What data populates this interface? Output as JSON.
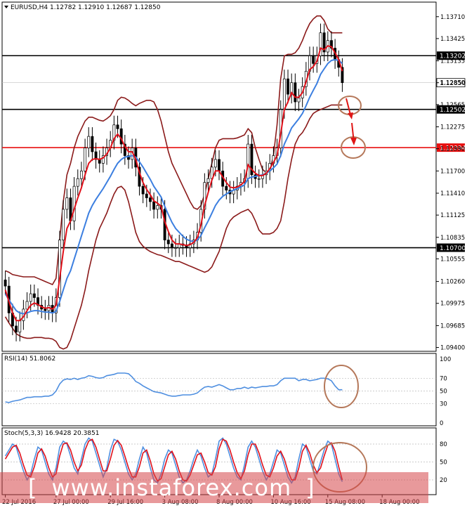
{
  "watermark": {
    "text": "www.instaforex.com",
    "bracket_left": "[",
    "bracket_right": "]"
  },
  "colors": {
    "price_up": "#000000",
    "price_down": "#000000",
    "bands": "#8b1a1a",
    "ma_fast": "#e0101a",
    "ma_slow": "#3c7fe0",
    "level_black": "#000000",
    "level_red": "#e81010",
    "annotation": "#b5785a",
    "arrow": "#e01515",
    "rsi_line": "#4f8fe0",
    "stoch_main": "#4f8fe0",
    "stoch_signal": "#e0101a"
  },
  "chart_data": [
    {
      "type": "line",
      "title": "EURUSD,H4  1.12782 1.12910 1.12687 1.12850",
      "ylim": [
        1.0935,
        1.139
      ],
      "yticks": [
        "1.13710",
        "1.13425",
        "1.13135",
        "1.12850",
        "1.12565",
        "1.12275",
        "1.11990",
        "1.11700",
        "1.11410",
        "1.11125",
        "1.10835",
        "1.10555",
        "1.10260",
        "1.09975",
        "1.09685",
        "1.09400"
      ],
      "ytick_values": [
        1.1371,
        1.13425,
        1.13135,
        1.1285,
        1.12565,
        1.12275,
        1.1199,
        1.117,
        1.1141,
        1.11125,
        1.10835,
        1.10555,
        1.1026,
        1.09975,
        1.09685,
        1.094
      ],
      "xlabels": [
        "22 Jul 2016",
        "27 Jul 00:00",
        "29 Jul 16:00",
        "3 Aug 08:00",
        "8 Aug 00:00",
        "10 Aug 16:00",
        "15 Aug 08:00",
        "18 Aug 00:00"
      ],
      "xlabel_bars": [
        0,
        14,
        29,
        44,
        59,
        74,
        89,
        104
      ],
      "levels": [
        {
          "value": 1.13202,
          "label": "1.13202",
          "color": "#000000"
        },
        {
          "value": 1.12502,
          "label": "1.12502",
          "color": "#000000"
        },
        {
          "value": 1.12004,
          "label": "1.12004",
          "color": "#e81010"
        },
        {
          "value": 1.107,
          "label": "1.10700",
          "color": "#000000"
        }
      ],
      "current_price": {
        "value": 1.1285,
        "label": "1.12850"
      },
      "close": [
        1.102,
        1.0985,
        1.0968,
        1.096,
        1.0975,
        1.099,
        1.1,
        1.101,
        1.1005,
        1.0995,
        1.099,
        1.0988,
        1.0995,
        1.0985,
        1.1005,
        1.108,
        1.112,
        1.1135,
        1.1105,
        1.115,
        1.116,
        1.117,
        1.12,
        1.1215,
        1.1195,
        1.1185,
        1.118,
        1.119,
        1.12,
        1.121,
        1.123,
        1.1225,
        1.1205,
        1.119,
        1.1185,
        1.12,
        1.1175,
        1.115,
        1.114,
        1.1135,
        1.113,
        1.112,
        1.1125,
        1.112,
        1.108,
        1.1075,
        1.107,
        1.107,
        1.1075,
        1.1073,
        1.107,
        1.1075,
        1.108,
        1.109,
        1.112,
        1.1155,
        1.116,
        1.1175,
        1.1185,
        1.117,
        1.115,
        1.1145,
        1.114,
        1.1145,
        1.115,
        1.1155,
        1.116,
        1.1205,
        1.1165,
        1.116,
        1.116,
        1.1165,
        1.117,
        1.118,
        1.119,
        1.12,
        1.125,
        1.129,
        1.127,
        1.1285,
        1.126,
        1.1265,
        1.128,
        1.13,
        1.132,
        1.131,
        1.132,
        1.135,
        1.1325,
        1.134,
        1.133,
        1.1315,
        1.1305,
        1.1285
      ],
      "ma_fast": [
        1.1015,
        1.1,
        1.0985,
        1.0975,
        1.0975,
        1.098,
        1.0988,
        1.0995,
        1.0998,
        1.0996,
        1.0993,
        1.0991,
        1.0992,
        1.099,
        1.0995,
        1.103,
        1.1065,
        1.1095,
        1.1105,
        1.112,
        1.1135,
        1.1148,
        1.1165,
        1.118,
        1.1185,
        1.1186,
        1.1185,
        1.1187,
        1.1192,
        1.12,
        1.1212,
        1.1218,
        1.1212,
        1.1202,
        1.1195,
        1.1195,
        1.1185,
        1.1168,
        1.1155,
        1.1146,
        1.1139,
        1.1131,
        1.1128,
        1.1124,
        1.1104,
        1.1091,
        1.108,
        1.1075,
        1.1075,
        1.1074,
        1.1073,
        1.1074,
        1.1077,
        1.1083,
        1.11,
        1.1125,
        1.1142,
        1.1158,
        1.117,
        1.117,
        1.1162,
        1.1155,
        1.1149,
        1.1148,
        1.1149,
        1.1152,
        1.1156,
        1.1178,
        1.1172,
        1.1167,
        1.1164,
        1.1164,
        1.1167,
        1.1173,
        1.1181,
        1.119,
        1.1218,
        1.125,
        1.126,
        1.1272,
        1.1266,
        1.1266,
        1.1272,
        1.1286,
        1.1302,
        1.1306,
        1.1313,
        1.133,
        1.1328,
        1.1333,
        1.1332,
        1.1324,
        1.1315,
        1.13
      ],
      "ma_slow": [
        1.101,
        1.1002,
        1.0995,
        1.0988,
        1.0985,
        1.0984,
        1.0985,
        1.0987,
        1.0988,
        1.0988,
        1.0987,
        1.0986,
        1.0986,
        1.0985,
        1.0987,
        1.1,
        1.1015,
        1.103,
        1.104,
        1.1055,
        1.107,
        1.1085,
        1.11,
        1.1115,
        1.1125,
        1.1133,
        1.114,
        1.1147,
        1.1155,
        1.1163,
        1.1172,
        1.118,
        1.1185,
        1.1188,
        1.1189,
        1.119,
        1.1188,
        1.1182,
        1.1175,
        1.1167,
        1.1159,
        1.115,
        1.1143,
        1.1136,
        1.1124,
        1.1113,
        1.1103,
        1.1095,
        1.109,
        1.1085,
        1.1081,
        1.1079,
        1.1078,
        1.108,
        1.1086,
        1.1096,
        1.1105,
        1.1115,
        1.1125,
        1.1132,
        1.1137,
        1.114,
        1.1143,
        1.1145,
        1.1147,
        1.1149,
        1.1152,
        1.116,
        1.1162,
        1.1163,
        1.1164,
        1.1165,
        1.1167,
        1.117,
        1.1174,
        1.1179,
        1.119,
        1.1205,
        1.1215,
        1.1226,
        1.1232,
        1.1238,
        1.1245,
        1.1255,
        1.1266,
        1.1275,
        1.1284,
        1.1296,
        1.1303,
        1.131,
        1.1314,
        1.1315,
        1.1314,
        1.131
      ],
      "upper_band": [
        1.104,
        1.1038,
        1.1035,
        1.1034,
        1.1033,
        1.1032,
        1.1032,
        1.1032,
        1.1032,
        1.103,
        1.1028,
        1.1026,
        1.1024,
        1.1022,
        1.103,
        1.108,
        1.113,
        1.1165,
        1.118,
        1.12,
        1.1215,
        1.1225,
        1.1235,
        1.124,
        1.124,
        1.1238,
        1.1236,
        1.1235,
        1.1238,
        1.1242,
        1.125,
        1.1262,
        1.1266,
        1.1265,
        1.1262,
        1.1258,
        1.1255,
        1.1258,
        1.126,
        1.1262,
        1.1262,
        1.126,
        1.125,
        1.1235,
        1.1215,
        1.1195,
        1.118,
        1.117,
        1.116,
        1.115,
        1.114,
        1.113,
        1.1122,
        1.112,
        1.1125,
        1.114,
        1.116,
        1.118,
        1.12,
        1.121,
        1.1212,
        1.1212,
        1.1212,
        1.1212,
        1.1213,
        1.1215,
        1.1217,
        1.1225,
        1.122,
        1.12,
        1.1185,
        1.1172,
        1.1168,
        1.117,
        1.119,
        1.123,
        1.129,
        1.132,
        1.1322,
        1.1322,
        1.1324,
        1.133,
        1.134,
        1.1352,
        1.1362,
        1.1368,
        1.1372,
        1.1372,
        1.1366,
        1.1355,
        1.135,
        1.135,
        1.135,
        1.135
      ],
      "lower_band": [
        1.098,
        1.0972,
        1.0965,
        1.0958,
        1.0955,
        1.0953,
        1.0952,
        1.0952,
        1.0953,
        1.0953,
        1.0953,
        1.0952,
        1.0952,
        1.0951,
        1.0948,
        1.094,
        1.0938,
        1.094,
        1.095,
        1.0965,
        1.098,
        1.0995,
        1.1015,
        1.104,
        1.106,
        1.108,
        1.1095,
        1.1105,
        1.1115,
        1.1128,
        1.114,
        1.1148,
        1.115,
        1.1145,
        1.113,
        1.111,
        1.109,
        1.1078,
        1.1072,
        1.1068,
        1.1065,
        1.1063,
        1.1061,
        1.106,
        1.1058,
        1.1056,
        1.1054,
        1.1052,
        1.1052,
        1.105,
        1.1048,
        1.1046,
        1.1044,
        1.1042,
        1.104,
        1.1038,
        1.104,
        1.1045,
        1.1055,
        1.1065,
        1.108,
        1.1095,
        1.1105,
        1.111,
        1.1113,
        1.1116,
        1.1118,
        1.112,
        1.1115,
        1.1105,
        1.1093,
        1.1088,
        1.1088,
        1.1088,
        1.109,
        1.1095,
        1.1105,
        1.113,
        1.116,
        1.1185,
        1.1205,
        1.1215,
        1.122,
        1.1228,
        1.1238,
        1.1245,
        1.1248,
        1.125,
        1.1252,
        1.1254,
        1.1256,
        1.1256,
        1.1256,
        1.1256
      ]
    },
    {
      "type": "line",
      "title": "RSI(14) 51.8062",
      "ylim": [
        0,
        100
      ],
      "yticks": [
        "100",
        "70",
        "50",
        "30",
        "0"
      ],
      "ytick_values": [
        100,
        70,
        50,
        30,
        0
      ],
      "values": [
        33,
        32,
        34,
        35,
        36,
        38,
        40,
        40,
        41,
        41,
        41,
        42,
        42,
        44,
        50,
        61,
        67,
        69,
        68,
        70,
        68,
        70,
        71,
        74,
        73,
        71,
        70,
        71,
        74,
        75,
        76,
        78,
        78,
        78,
        77,
        72,
        65,
        62,
        58,
        55,
        52,
        49,
        48,
        47,
        45,
        43,
        42,
        42,
        43,
        44,
        44,
        44,
        45,
        47,
        52,
        56,
        57,
        56,
        58,
        60,
        58,
        55,
        52,
        52,
        54,
        54,
        56,
        54,
        56,
        55,
        56,
        57,
        57,
        58,
        58,
        60,
        66,
        70,
        70,
        70,
        70,
        66,
        68,
        68,
        66,
        67,
        68,
        70,
        70,
        69,
        66,
        58,
        52,
        52
      ]
    },
    {
      "type": "line",
      "title": "Stoch(5,3,3) 16.9428 20.3851",
      "ylim": [
        0,
        100
      ],
      "yticks": [
        "80",
        "50",
        "20"
      ],
      "ytick_values": [
        80,
        50,
        20
      ],
      "main": [
        60,
        70,
        80,
        75,
        55,
        35,
        20,
        30,
        55,
        75,
        70,
        50,
        30,
        20,
        40,
        75,
        85,
        80,
        60,
        40,
        30,
        55,
        80,
        90,
        85,
        65,
        45,
        25,
        40,
        70,
        88,
        85,
        70,
        50,
        30,
        20,
        30,
        55,
        75,
        65,
        40,
        20,
        15,
        30,
        55,
        70,
        65,
        45,
        25,
        15,
        20,
        35,
        55,
        70,
        60,
        40,
        25,
        30,
        55,
        85,
        90,
        80,
        60,
        40,
        25,
        20,
        45,
        75,
        85,
        75,
        55,
        35,
        20,
        30,
        50,
        70,
        65,
        45,
        25,
        15,
        25,
        55,
        80,
        75,
        55,
        35,
        30,
        50,
        70,
        85,
        80,
        55,
        30,
        17
      ],
      "signal": [
        55,
        65,
        75,
        78,
        65,
        45,
        28,
        25,
        42,
        65,
        72,
        60,
        40,
        25,
        30,
        60,
        80,
        82,
        70,
        50,
        35,
        45,
        70,
        85,
        88,
        75,
        55,
        35,
        35,
        55,
        78,
        86,
        78,
        60,
        40,
        25,
        25,
        42,
        65,
        70,
        52,
        30,
        18,
        22,
        42,
        62,
        68,
        55,
        35,
        20,
        18,
        28,
        45,
        62,
        65,
        50,
        32,
        28,
        42,
        72,
        88,
        85,
        70,
        50,
        32,
        22,
        35,
        62,
        80,
        80,
        65,
        45,
        28,
        25,
        40,
        60,
        68,
        55,
        35,
        20,
        20,
        40,
        68,
        78,
        65,
        45,
        32,
        40,
        60,
        78,
        82,
        68,
        42,
        20
      ]
    }
  ]
}
